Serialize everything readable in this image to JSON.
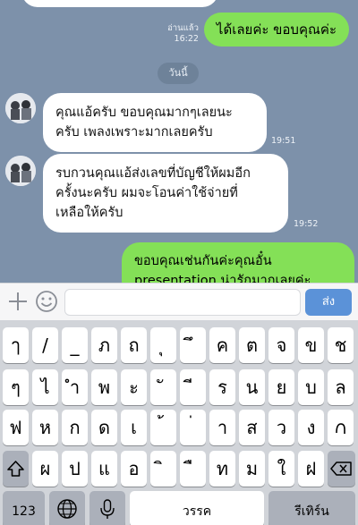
{
  "chat": {
    "out_msg_1": {
      "read": "อ่านแล้ว",
      "time": "16:22",
      "text": "ได้เลยค่ะ ขอบคุณค่ะ"
    },
    "day_separator": "วันนี้",
    "in_msg_1": {
      "lines": [
        "คุณแอ้ครับ ขอบคุณมากๆเลยนะ",
        "ครับ เพลงเพราะมากเลยครับ"
      ],
      "time": "19:51"
    },
    "in_msg_2": {
      "lines": [
        "รบกวนคุณแอ้ส่งเลขที่บัญชีให้ผมอีก",
        "ครั้งนะครับ ผมจะโอนค่าใช้จ่ายที่",
        "เหลือให้ครับ"
      ],
      "time": "19:52"
    },
    "out_msg_2": {
      "lines": [
        "ขอบคุณเช่นกันค่ะคุณอั๋น",
        "presentation น่ารักมากเลยค่ะ"
      ]
    }
  },
  "input_bar": {
    "placeholder": "",
    "send_label": "ส่ง"
  },
  "keyboard": {
    "row1": [
      "ๅ",
      "/",
      "_",
      "ภ",
      "ถ",
      "ุ",
      "ึ",
      "ค",
      "ต",
      "จ",
      "ข",
      "ช"
    ],
    "row2": [
      "ๆ",
      "ไ",
      "ำ",
      "พ",
      "ะ",
      "ั",
      "ี",
      "ร",
      "น",
      "ย",
      "บ",
      "ล"
    ],
    "row3": [
      "ฟ",
      "ห",
      "ก",
      "ด",
      "เ",
      "้",
      "่",
      "า",
      "ส",
      "ว",
      "ง"
    ],
    "row4": [
      "ผ",
      "ป",
      "แ",
      "อ",
      "ิ",
      "ื",
      "ท",
      "ม",
      "ใ",
      "ฝ"
    ],
    "numbers_label": "123",
    "space_label": "วรรค",
    "return_label": "รีเทิร์น"
  }
}
